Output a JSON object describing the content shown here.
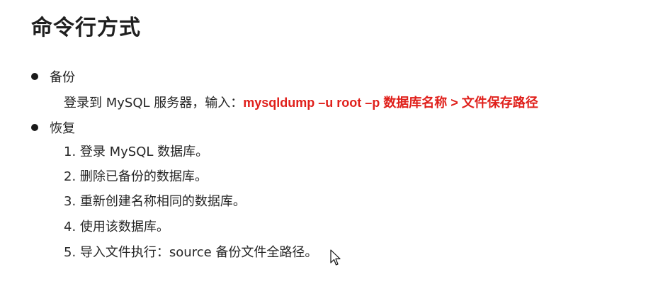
{
  "title": "命令行方式",
  "backup": {
    "label": "备份",
    "line_prefix": "登录到 MySQL 服务器，输入：",
    "command": "mysqldump –u root –p 数据库名称 > 文件保存路径"
  },
  "restore": {
    "label": "恢复",
    "steps": [
      "1. 登录 MySQL 数据库。",
      "2. 删除已备份的数据库。",
      "3. 重新创建名称相同的数据库。",
      "4. 使用该数据库。",
      "5. 导入文件执行：source 备份文件全路径。"
    ]
  },
  "colors": {
    "command_red": "#e0201b",
    "text": "#222222"
  },
  "icons": {
    "bullet": "bullet-dot-icon",
    "pointer": "mouse-pointer-icon"
  }
}
